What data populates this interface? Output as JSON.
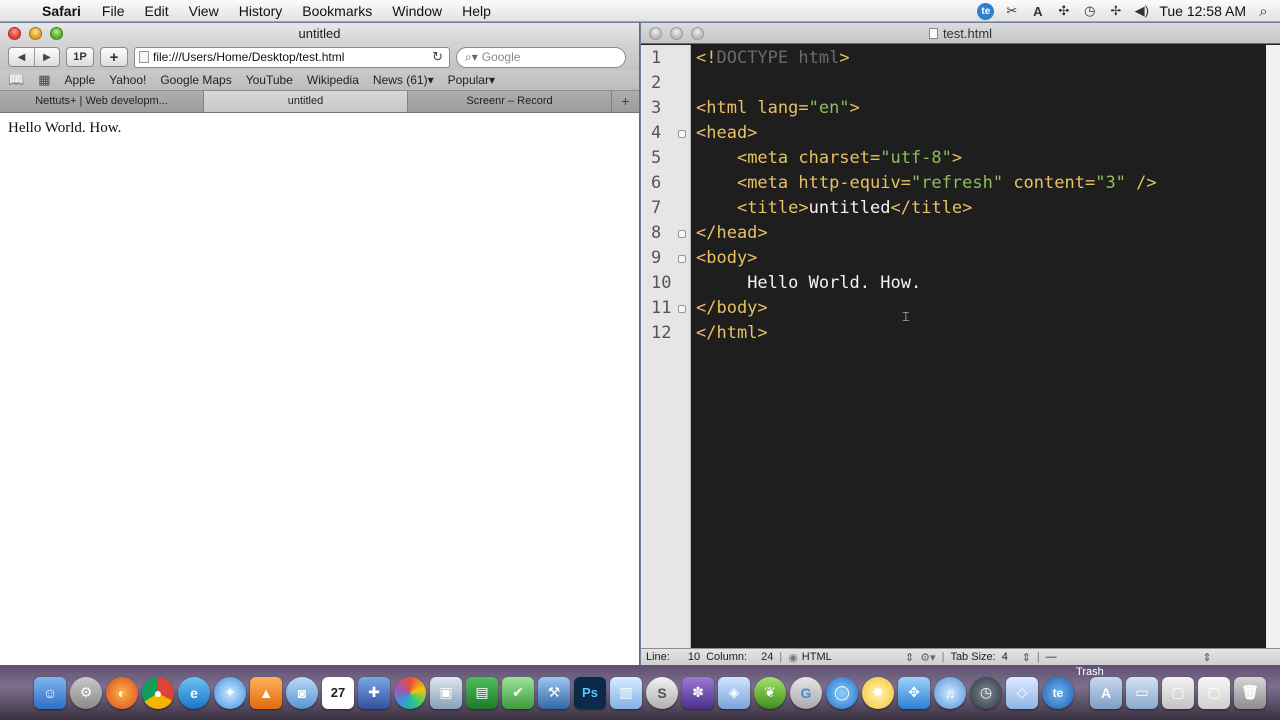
{
  "menubar": {
    "app": "Safari",
    "items": [
      "File",
      "Edit",
      "View",
      "History",
      "Bookmarks",
      "Window",
      "Help"
    ],
    "clock": "Tue 12:58 AM",
    "status_icons": [
      "textexpander-icon",
      "scissors-icon",
      "font-icon",
      "network-icon",
      "time-machine-icon",
      "bluetooth-icon",
      "volume-icon"
    ]
  },
  "safari": {
    "title": "untitled",
    "url": "file:///Users/Home/Desktop/test.html",
    "search_placeholder": "Google",
    "onep_label": "1P",
    "bookmarks": [
      "Apple",
      "Yahoo!",
      "Google Maps",
      "YouTube",
      "Wikipedia",
      "News (61)▾",
      "Popular▾"
    ],
    "tabs": [
      {
        "label": "Nettuts+ | Web developm...",
        "active": false
      },
      {
        "label": "untitled",
        "active": true
      },
      {
        "label": "Screenr – Record",
        "active": false
      }
    ],
    "page_text": "Hello World. How."
  },
  "editor": {
    "title": "test.html",
    "line_numbers": [
      "1",
      "2",
      "3",
      "4",
      "5",
      "6",
      "7",
      "8",
      "9",
      "10",
      "11",
      "12"
    ],
    "status": {
      "line_label": "Line:",
      "line": "10",
      "column_label": "Column:",
      "column": "24",
      "language": "HTML",
      "tab_size_label": "Tab Size:",
      "tab_size": "4",
      "symbol": "—"
    }
  },
  "dock": {
    "trash_label": "Trash"
  },
  "colors": {
    "editor_bg": "#1e1e1e",
    "tag": "#e9c062",
    "string": "#8fbe5a",
    "doctype": "#6b6b6b"
  }
}
